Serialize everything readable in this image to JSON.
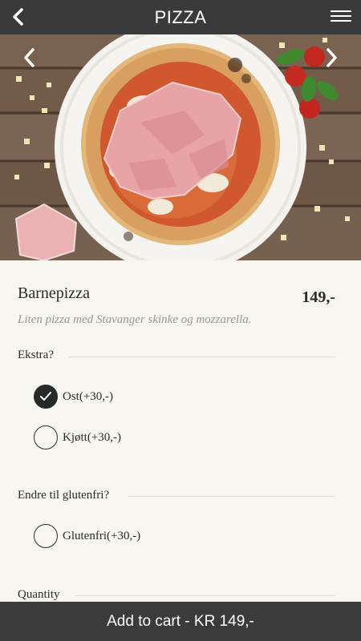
{
  "header": {
    "title": "PIZZA",
    "back_icon": "chevron-left-icon",
    "menu_icon": "hamburger-menu-icon"
  },
  "hero": {
    "prev_icon": "chevron-left-icon",
    "next_icon": "chevron-right-icon"
  },
  "item": {
    "name": "Barnepizza",
    "price": "149,-",
    "description": "Liten pizza med Stavanger skinke og mozzarella."
  },
  "sections": [
    {
      "title": "Ekstra?",
      "options": [
        {
          "label": "Ost(+30,-)",
          "checked": true
        },
        {
          "label": "Kjøtt(+30,-)",
          "checked": false
        }
      ]
    },
    {
      "title": "Endre til glutenfri?",
      "options": [
        {
          "label": "Glutenfri(+30,-)",
          "checked": false
        }
      ]
    },
    {
      "title": "Quantity",
      "options": []
    }
  ],
  "footer": {
    "cta_label": "Add to cart - KR 149,-"
  },
  "colors": {
    "header_bg": "#3a3a3a",
    "page_bg": "#f8f6f1",
    "checked_bg": "#262a28",
    "footer_bg": "#3b3b3b"
  }
}
